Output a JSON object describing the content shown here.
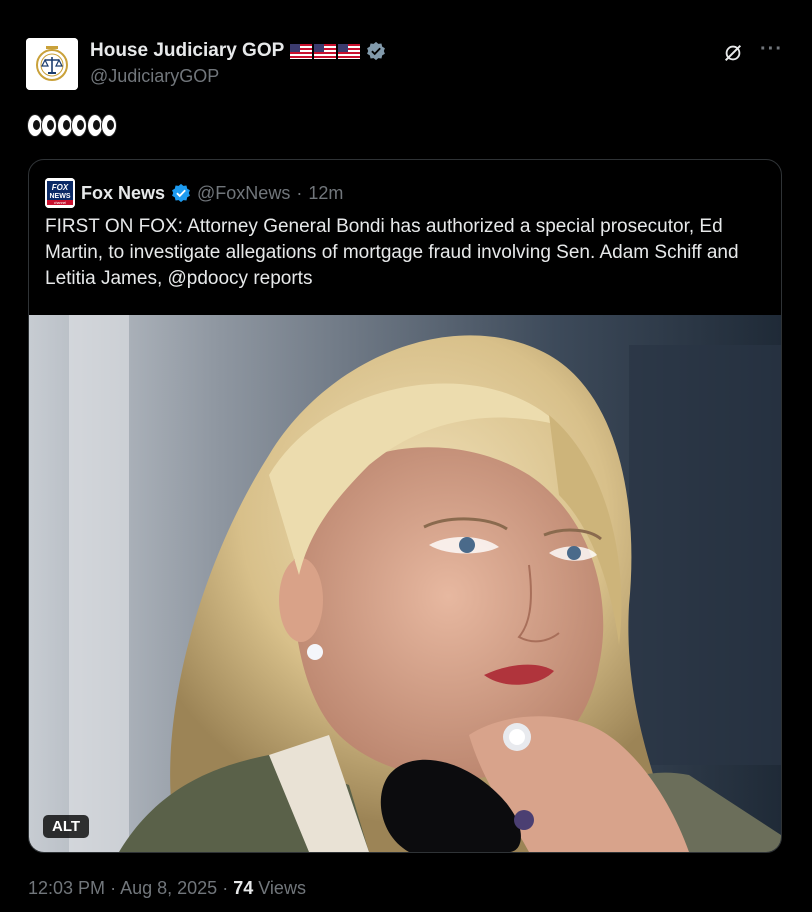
{
  "author": {
    "display_name": "House Judiciary GOP",
    "handle": "@JudiciaryGOP",
    "flag_count": 3
  },
  "tweet": {
    "text_emoji": "👀👀👀"
  },
  "quoted": {
    "display_name": "Fox News",
    "handle": "@FoxNews",
    "separator": "·",
    "age": "12m",
    "text": "FIRST ON FOX: Attorney General Bondi has authorized a special prosecutor, Ed Martin, to investigate allegations of mortgage fraud involving Sen. Adam Schiff and Letitia James, @pdoocy reports",
    "alt_label": "ALT",
    "logo_text_top": "FOX",
    "logo_text_mid": "NEWS",
    "logo_text_bottom": "channel"
  },
  "footer": {
    "time": "12:03 PM",
    "sep1": "·",
    "date": "Aug 8, 2025",
    "sep2": "·",
    "views_count": "74",
    "views_label": "Views"
  },
  "colors": {
    "background": "#000000",
    "text_primary": "#e7e9ea",
    "text_secondary": "#71767b",
    "verified_blue": "#1d9bf0",
    "border": "#2f3336"
  },
  "icons": [
    "seal-avatar-icon",
    "us-flag-icon",
    "verified-badge-icon",
    "grok-icon",
    "more-icon",
    "eyes-emoji-icon",
    "fox-news-logo-icon"
  ]
}
